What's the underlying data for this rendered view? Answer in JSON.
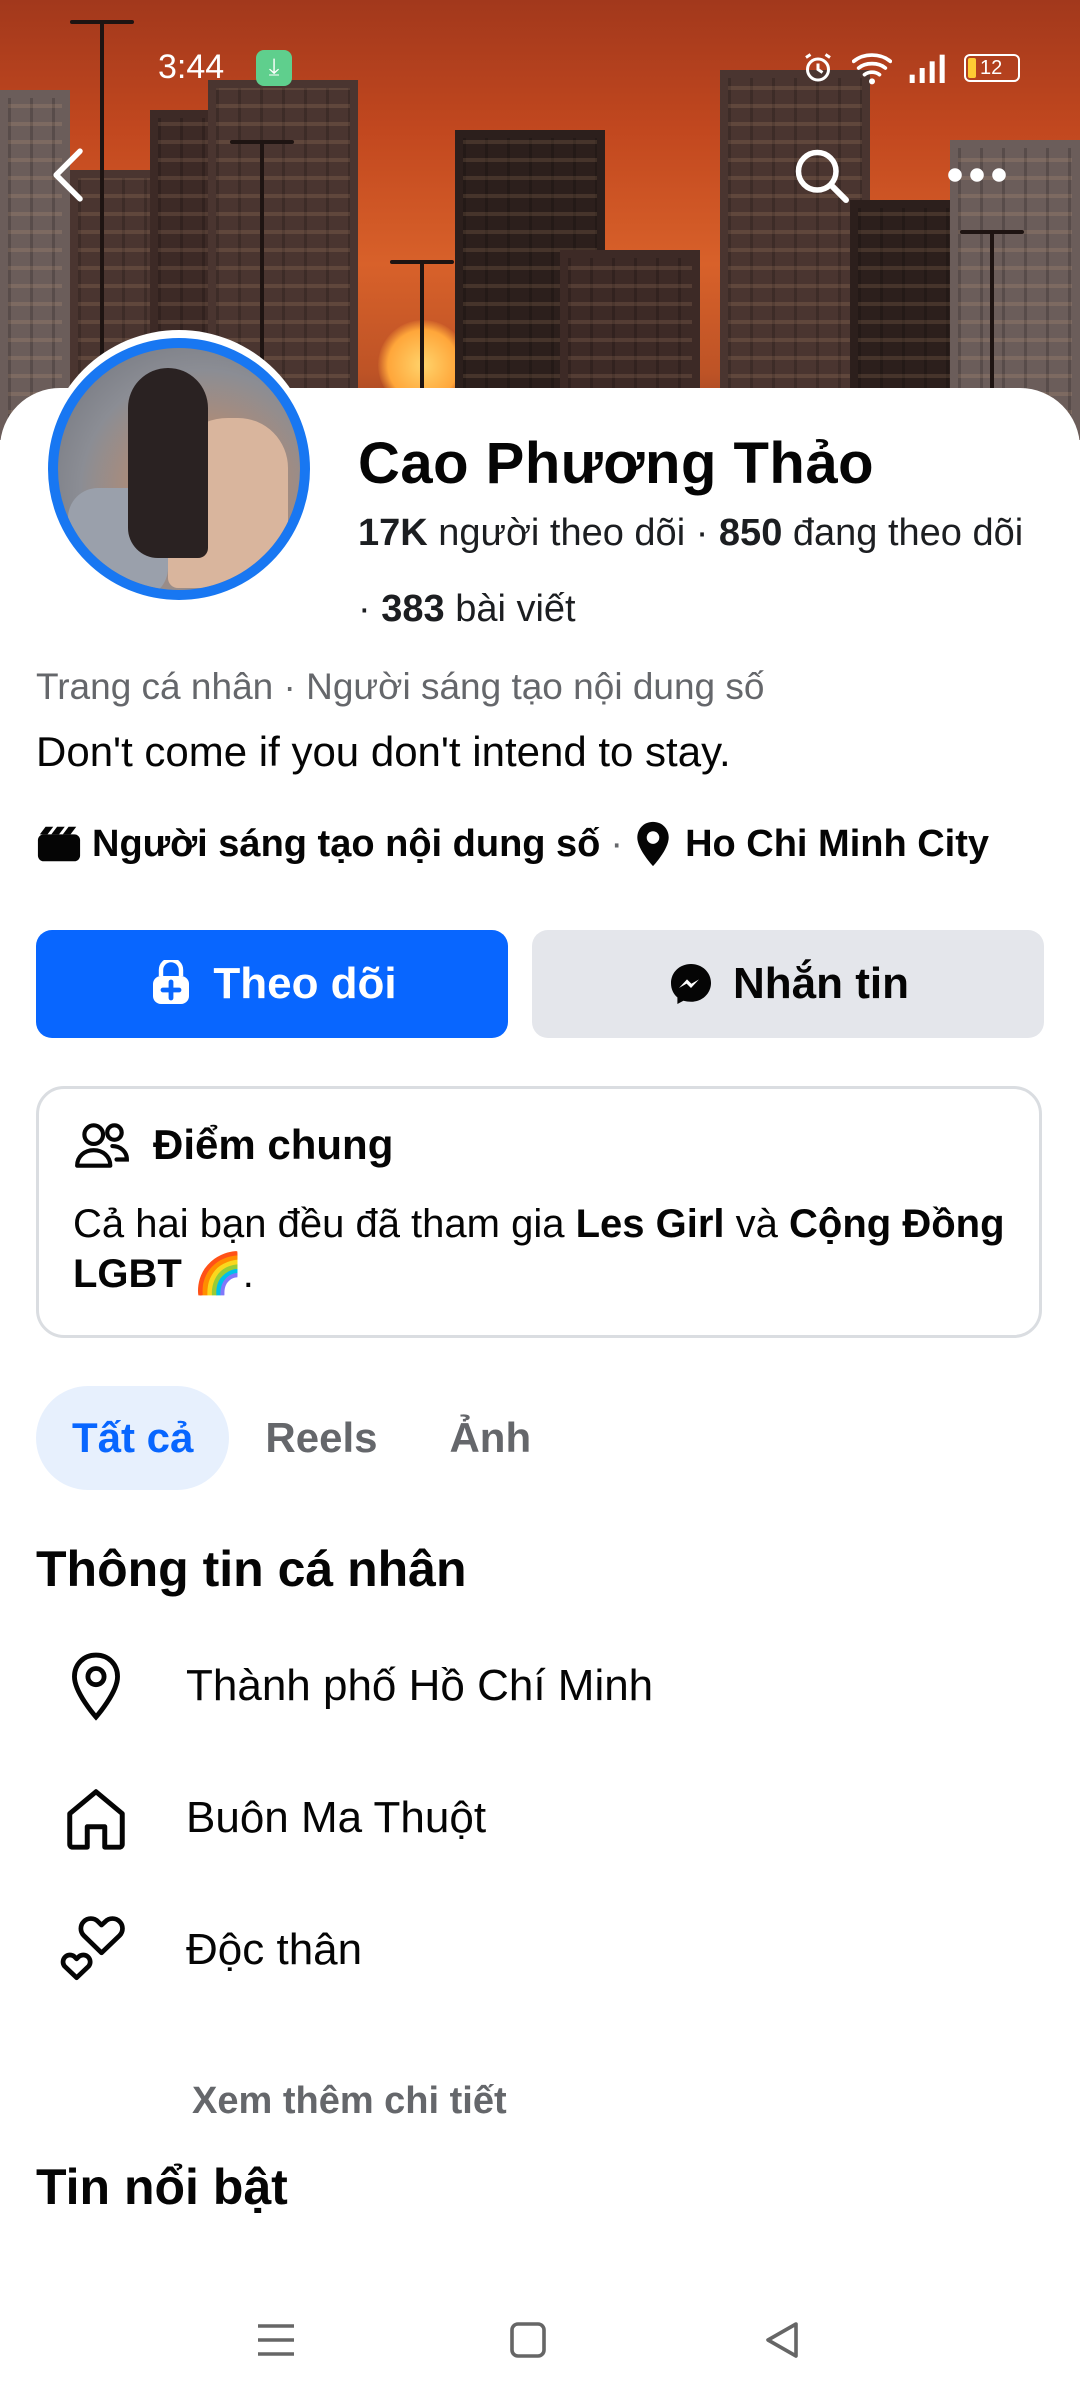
{
  "status_bar": {
    "time": "3:44",
    "battery": "12"
  },
  "profile": {
    "name": "Cao Phương Thảo",
    "followers_count": "17K",
    "followers_label": "người theo dõi",
    "following_count": "850",
    "following_label": "đang theo dõi",
    "posts_count": "383",
    "posts_label": "bài viết",
    "category": "Trang cá nhân · Người sáng tạo nội dung số",
    "bio": "Don't come if you don't intend to stay.",
    "meta_role": "Người sáng tạo nội dung số",
    "meta_location": "Ho Chi Minh City"
  },
  "actions": {
    "follow_label": "Theo dõi",
    "message_label": "Nhắn tin"
  },
  "mutual": {
    "title": "Điểm chung",
    "text_prefix": "Cả hai bạn đều đã tham gia ",
    "group1": "Les Girl",
    "text_and": " và ",
    "group2": "Cộng Đồng LGBT 🌈",
    "text_suffix": "."
  },
  "tabs": [
    {
      "label": "Tất cả",
      "active": true
    },
    {
      "label": "Reels",
      "active": false
    },
    {
      "label": "Ảnh",
      "active": false
    }
  ],
  "about": {
    "title": "Thông tin cá nhân",
    "items": [
      {
        "icon": "location-pin-icon",
        "text": "Thành phố Hồ Chí Minh"
      },
      {
        "icon": "home-icon",
        "text": "Buôn Ma Thuột"
      },
      {
        "icon": "hearts-icon",
        "text": "Độc thân"
      }
    ],
    "see_more": "Xem thêm chi tiết"
  },
  "highlights": {
    "title": "Tin nổi bật"
  },
  "colors": {
    "primary": "#0866ff",
    "avatar_ring": "#1877f2",
    "secondary_button": "#e4e6eb",
    "muted_text": "#65676b"
  }
}
